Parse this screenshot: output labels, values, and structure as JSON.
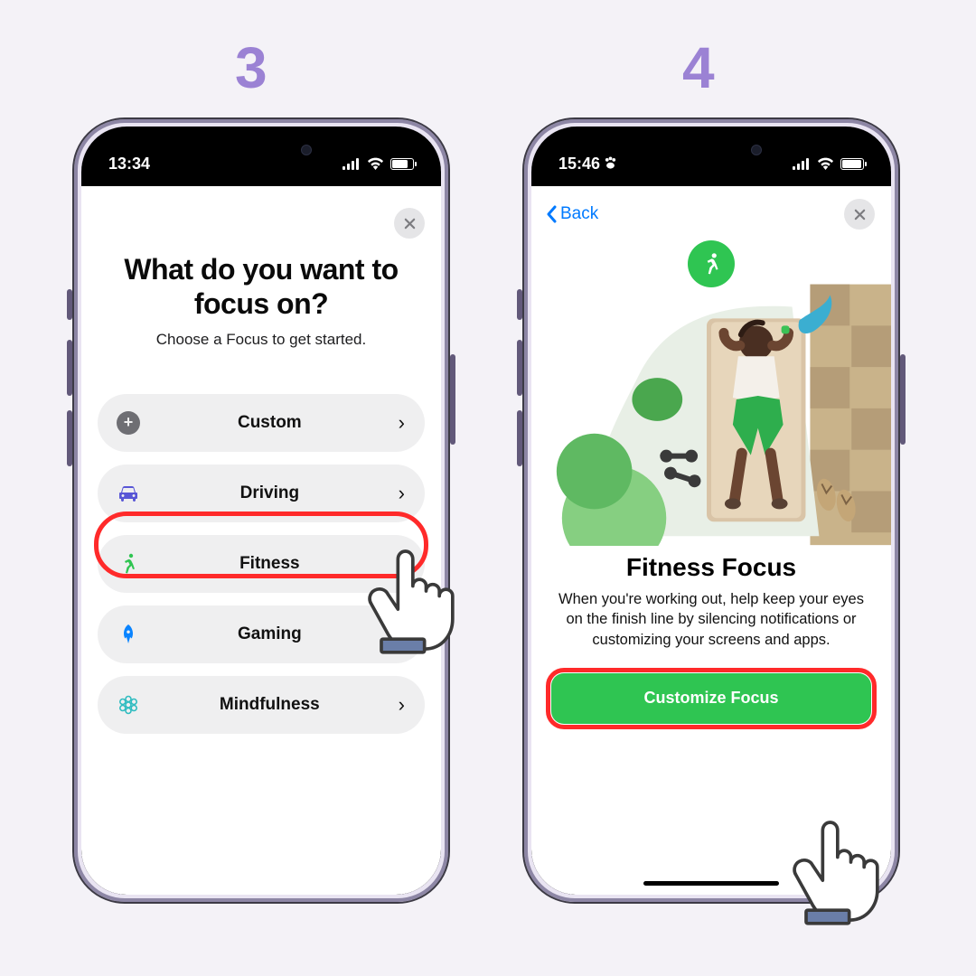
{
  "steps": {
    "s3": "3",
    "s4": "4"
  },
  "phone1": {
    "status": {
      "time": "13:34"
    },
    "title": "What do you want to focus on?",
    "subtitle": "Choose a Focus to get started.",
    "items": [
      {
        "label": "Custom",
        "icon": "plus-icon",
        "color": "gray"
      },
      {
        "label": "Driving",
        "icon": "car-icon",
        "color": "indigo"
      },
      {
        "label": "Fitness",
        "icon": "runner-icon",
        "color": "green"
      },
      {
        "label": "Gaming",
        "icon": "rocket-icon",
        "color": "blue"
      },
      {
        "label": "Mindfulness",
        "icon": "mind-icon",
        "color": "teal"
      }
    ]
  },
  "phone2": {
    "status": {
      "time": "15:46"
    },
    "back": "Back",
    "title": "Fitness Focus",
    "desc": "When you're working out, help keep your eyes on the finish line by silencing notifications or customizing your screens and apps.",
    "cta": "Customize Focus"
  },
  "colors": {
    "accent": "#9b82d4",
    "highlight": "#ff2a2a",
    "green": "#2fc552",
    "iosblue": "#007aff"
  }
}
